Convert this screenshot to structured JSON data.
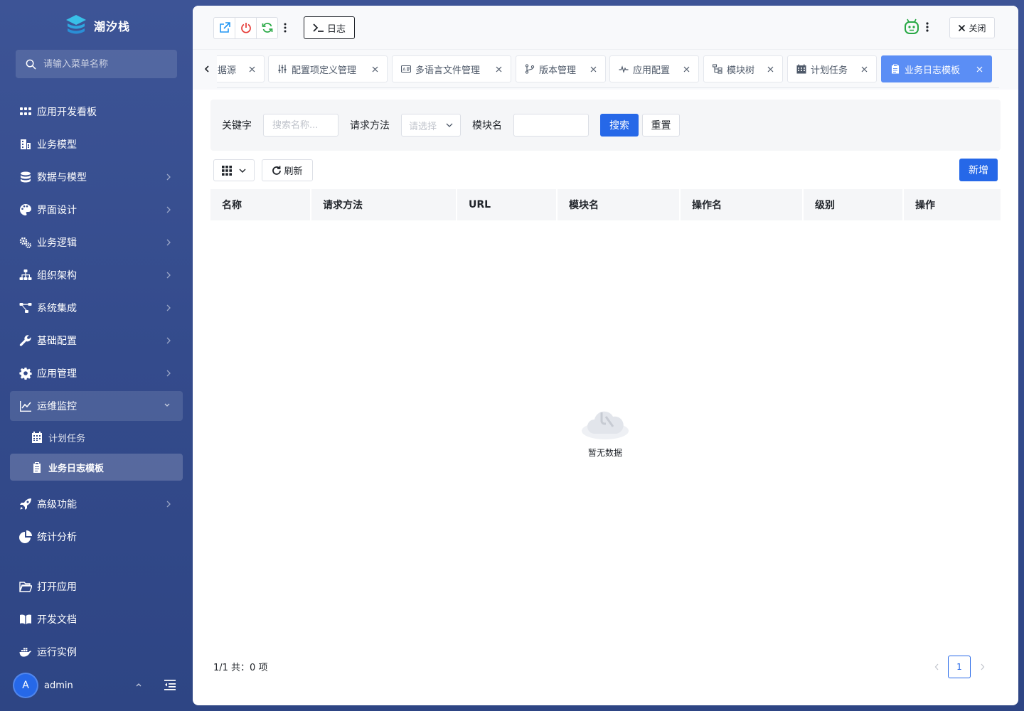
{
  "brand": {
    "name": "潮汐栈"
  },
  "menu": {
    "search_placeholder": "请输入菜单名称",
    "items": [
      {
        "label": "应用开发看板",
        "icon": "grid-icon"
      },
      {
        "label": "业务模型",
        "icon": "building-icon"
      },
      {
        "label": "数据与模型",
        "icon": "database-icon"
      },
      {
        "label": "界面设计",
        "icon": "palette-icon"
      },
      {
        "label": "业务逻辑",
        "icon": "cogs-icon"
      },
      {
        "label": "组织架构",
        "icon": "sitemap-icon"
      },
      {
        "label": "系统集成",
        "icon": "integration-icon"
      },
      {
        "label": "基础配置",
        "icon": "wrench-icon"
      },
      {
        "label": "应用管理",
        "icon": "gear-icon"
      },
      {
        "label": "运维监控",
        "icon": "line-chart-icon"
      },
      {
        "label": "计划任务",
        "icon": "calendar-icon"
      },
      {
        "label": "业务日志模板",
        "icon": "clipboard-icon"
      },
      {
        "label": "高级功能",
        "icon": "rocket-icon"
      },
      {
        "label": "统计分析",
        "icon": "pie-chart-icon"
      },
      {
        "label": "打开应用",
        "icon": "folder-open-icon"
      },
      {
        "label": "开发文档",
        "icon": "book-icon"
      },
      {
        "label": "运行实例",
        "icon": "docker-icon"
      }
    ]
  },
  "user": {
    "avatar_letter": "A",
    "name": "admin"
  },
  "toolbar": {
    "log_label": "日志",
    "close_label": "关闭"
  },
  "tabs": [
    {
      "label": "据源",
      "icon": "database-icon"
    },
    {
      "label": "配置项定义管理",
      "icon": "sliders-icon"
    },
    {
      "label": "多语言文件管理",
      "icon": "language-icon"
    },
    {
      "label": "版本管理",
      "icon": "branch-icon"
    },
    {
      "label": "应用配置",
      "icon": "pulse-icon"
    },
    {
      "label": "模块树",
      "icon": "tree-icon"
    },
    {
      "label": "计划任务",
      "icon": "calendar-icon"
    },
    {
      "label": "业务日志模板",
      "icon": "clipboard-icon"
    }
  ],
  "filters": {
    "keyword_label": "关键字",
    "keyword_placeholder": "搜索名称...",
    "method_label": "请求方法",
    "method_placeholder": "请选择",
    "module_label": "模块名",
    "module_value": "",
    "search_label": "搜索",
    "reset_label": "重置"
  },
  "actions": {
    "refresh_label": "刷新",
    "add_label": "新增"
  },
  "table": {
    "columns": [
      "名称",
      "请求方法",
      "URL",
      "模块名",
      "操作名",
      "级别",
      "操作"
    ],
    "empty_text": "暂无数据"
  },
  "pagination": {
    "summary": "1/1 共：0 项",
    "current_page": "1"
  },
  "colors": {
    "primary": "#2668e8",
    "active_tab": "#5b8ef5",
    "sidebar": "#3a5193"
  }
}
